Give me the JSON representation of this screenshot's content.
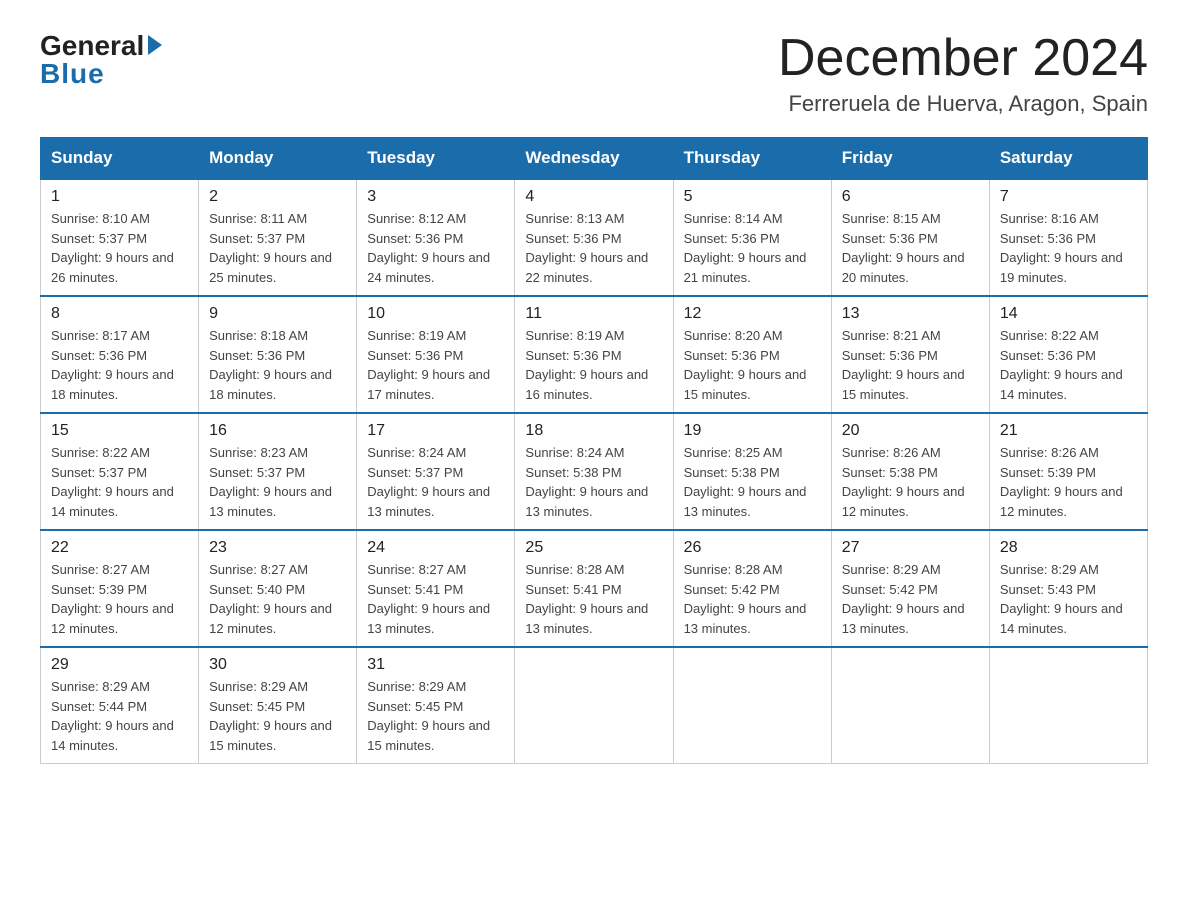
{
  "logo": {
    "general": "General",
    "blue": "Blue"
  },
  "header": {
    "title": "December 2024",
    "subtitle": "Ferreruela de Huerva, Aragon, Spain"
  },
  "days_of_week": [
    "Sunday",
    "Monday",
    "Tuesday",
    "Wednesday",
    "Thursday",
    "Friday",
    "Saturday"
  ],
  "weeks": [
    [
      {
        "num": "1",
        "sunrise": "8:10 AM",
        "sunset": "5:37 PM",
        "daylight": "9 hours and 26 minutes."
      },
      {
        "num": "2",
        "sunrise": "8:11 AM",
        "sunset": "5:37 PM",
        "daylight": "9 hours and 25 minutes."
      },
      {
        "num": "3",
        "sunrise": "8:12 AM",
        "sunset": "5:36 PM",
        "daylight": "9 hours and 24 minutes."
      },
      {
        "num": "4",
        "sunrise": "8:13 AM",
        "sunset": "5:36 PM",
        "daylight": "9 hours and 22 minutes."
      },
      {
        "num": "5",
        "sunrise": "8:14 AM",
        "sunset": "5:36 PM",
        "daylight": "9 hours and 21 minutes."
      },
      {
        "num": "6",
        "sunrise": "8:15 AM",
        "sunset": "5:36 PM",
        "daylight": "9 hours and 20 minutes."
      },
      {
        "num": "7",
        "sunrise": "8:16 AM",
        "sunset": "5:36 PM",
        "daylight": "9 hours and 19 minutes."
      }
    ],
    [
      {
        "num": "8",
        "sunrise": "8:17 AM",
        "sunset": "5:36 PM",
        "daylight": "9 hours and 18 minutes."
      },
      {
        "num": "9",
        "sunrise": "8:18 AM",
        "sunset": "5:36 PM",
        "daylight": "9 hours and 18 minutes."
      },
      {
        "num": "10",
        "sunrise": "8:19 AM",
        "sunset": "5:36 PM",
        "daylight": "9 hours and 17 minutes."
      },
      {
        "num": "11",
        "sunrise": "8:19 AM",
        "sunset": "5:36 PM",
        "daylight": "9 hours and 16 minutes."
      },
      {
        "num": "12",
        "sunrise": "8:20 AM",
        "sunset": "5:36 PM",
        "daylight": "9 hours and 15 minutes."
      },
      {
        "num": "13",
        "sunrise": "8:21 AM",
        "sunset": "5:36 PM",
        "daylight": "9 hours and 15 minutes."
      },
      {
        "num": "14",
        "sunrise": "8:22 AM",
        "sunset": "5:36 PM",
        "daylight": "9 hours and 14 minutes."
      }
    ],
    [
      {
        "num": "15",
        "sunrise": "8:22 AM",
        "sunset": "5:37 PM",
        "daylight": "9 hours and 14 minutes."
      },
      {
        "num": "16",
        "sunrise": "8:23 AM",
        "sunset": "5:37 PM",
        "daylight": "9 hours and 13 minutes."
      },
      {
        "num": "17",
        "sunrise": "8:24 AM",
        "sunset": "5:37 PM",
        "daylight": "9 hours and 13 minutes."
      },
      {
        "num": "18",
        "sunrise": "8:24 AM",
        "sunset": "5:38 PM",
        "daylight": "9 hours and 13 minutes."
      },
      {
        "num": "19",
        "sunrise": "8:25 AM",
        "sunset": "5:38 PM",
        "daylight": "9 hours and 13 minutes."
      },
      {
        "num": "20",
        "sunrise": "8:26 AM",
        "sunset": "5:38 PM",
        "daylight": "9 hours and 12 minutes."
      },
      {
        "num": "21",
        "sunrise": "8:26 AM",
        "sunset": "5:39 PM",
        "daylight": "9 hours and 12 minutes."
      }
    ],
    [
      {
        "num": "22",
        "sunrise": "8:27 AM",
        "sunset": "5:39 PM",
        "daylight": "9 hours and 12 minutes."
      },
      {
        "num": "23",
        "sunrise": "8:27 AM",
        "sunset": "5:40 PM",
        "daylight": "9 hours and 12 minutes."
      },
      {
        "num": "24",
        "sunrise": "8:27 AM",
        "sunset": "5:41 PM",
        "daylight": "9 hours and 13 minutes."
      },
      {
        "num": "25",
        "sunrise": "8:28 AM",
        "sunset": "5:41 PM",
        "daylight": "9 hours and 13 minutes."
      },
      {
        "num": "26",
        "sunrise": "8:28 AM",
        "sunset": "5:42 PM",
        "daylight": "9 hours and 13 minutes."
      },
      {
        "num": "27",
        "sunrise": "8:29 AM",
        "sunset": "5:42 PM",
        "daylight": "9 hours and 13 minutes."
      },
      {
        "num": "28",
        "sunrise": "8:29 AM",
        "sunset": "5:43 PM",
        "daylight": "9 hours and 14 minutes."
      }
    ],
    [
      {
        "num": "29",
        "sunrise": "8:29 AM",
        "sunset": "5:44 PM",
        "daylight": "9 hours and 14 minutes."
      },
      {
        "num": "30",
        "sunrise": "8:29 AM",
        "sunset": "5:45 PM",
        "daylight": "9 hours and 15 minutes."
      },
      {
        "num": "31",
        "sunrise": "8:29 AM",
        "sunset": "5:45 PM",
        "daylight": "9 hours and 15 minutes."
      },
      null,
      null,
      null,
      null
    ]
  ]
}
